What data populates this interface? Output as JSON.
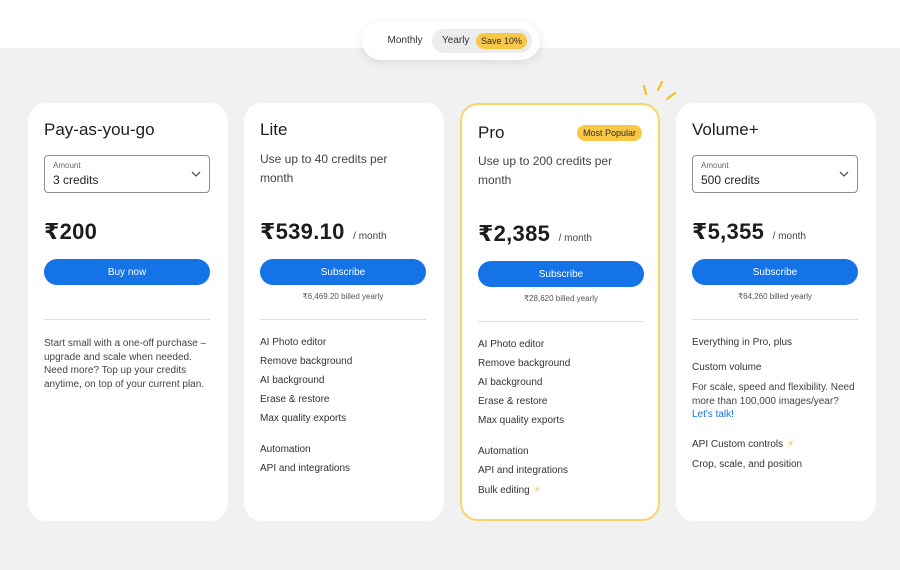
{
  "toggle": {
    "monthly": "Monthly",
    "yearly": "Yearly",
    "save": "Save 10%"
  },
  "cards": [
    {
      "title": "Pay-as-you-go",
      "amount_label": "Amount",
      "amount_value": "3 credits",
      "price": "₹200",
      "button": "Buy now",
      "blurb": "Start small with a one-off purchase – upgrade and scale when needed. Need more? Top up your credits anytime, on top of your current plan."
    },
    {
      "title": "Lite",
      "desc": "Use up to 40 credits per month",
      "price": "₹539.10",
      "per": "/ month",
      "button": "Subscribe",
      "billed": "₹6,469.20 billed yearly",
      "features": [
        "AI Photo editor",
        "Remove background",
        "AI background",
        "Erase & restore",
        "Max quality exports"
      ],
      "section2": "Automation",
      "features2": [
        "API and integrations"
      ]
    },
    {
      "title": "Pro",
      "badge": "Most Popular",
      "desc": "Use up to 200 credits per month",
      "price": "₹2,385",
      "per": "/ month",
      "button": "Subscribe",
      "billed": "₹28,620 billed yearly",
      "features": [
        "AI Photo editor",
        "Remove background",
        "AI background",
        "Erase & restore",
        "Max quality exports"
      ],
      "section2": "Automation",
      "features2": [
        "API and integrations",
        "Bulk editing"
      ]
    },
    {
      "title": "Volume+",
      "amount_label": "Amount",
      "amount_value": "500 credits",
      "price": "₹5,355",
      "per": "/ month",
      "button": "Subscribe",
      "billed": "₹64,260 billed yearly",
      "intro": "Everything in Pro, plus",
      "custom_title": "Custom volume",
      "custom_text": "For scale, speed and flexibility. Need more than 100,000 images/year?",
      "custom_link": "Let's talk!",
      "api_controls": "API Custom controls",
      "api_text": "Crop, scale, and position"
    }
  ],
  "colors": {
    "accent": "#1473e6",
    "badge": "#f9c846",
    "pro_border": "#f6d36b"
  }
}
